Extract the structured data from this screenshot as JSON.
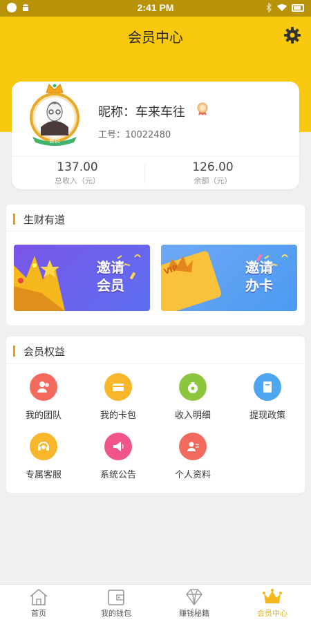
{
  "status_bar": {
    "time": "2:41 PM"
  },
  "header": {
    "title": "会员中心"
  },
  "profile": {
    "nickname": "昵称：车来车往",
    "employee_id": "工号：10022480",
    "avatar_badge": "会员",
    "stats": [
      {
        "value": "137.00",
        "label": "总收入（元）"
      },
      {
        "value": "126.00",
        "label": "余额（元）"
      }
    ]
  },
  "earn_section": {
    "title": "生财有道",
    "banners": [
      {
        "line1": "邀请",
        "line2": "会员"
      },
      {
        "line1": "邀请",
        "line2": "办卡",
        "tag": "VIP"
      }
    ]
  },
  "benefits_section": {
    "title": "会员权益",
    "items": [
      {
        "label": "我的团队",
        "icon": "team-icon",
        "color": "#f26a5e"
      },
      {
        "label": "我的卡包",
        "icon": "card-wallet-icon",
        "color": "#f8b62a"
      },
      {
        "label": "收入明细",
        "icon": "money-bag-icon",
        "color": "#8cc63f"
      },
      {
        "label": "提现政策",
        "icon": "book-icon",
        "color": "#4fa6f0"
      },
      {
        "label": "专属客服",
        "icon": "headset-icon",
        "color": "#f8b62a"
      },
      {
        "label": "系统公告",
        "icon": "megaphone-icon",
        "color": "#f0548a"
      },
      {
        "label": "个人资料",
        "icon": "profile-card-icon",
        "color": "#f26a5e"
      }
    ]
  },
  "tabbar": {
    "tabs": [
      {
        "label": "首页",
        "icon": "home-icon",
        "active": false
      },
      {
        "label": "我的钱包",
        "icon": "wallet-icon",
        "active": false
      },
      {
        "label": "赚钱秘籍",
        "icon": "diamond-icon",
        "active": false
      },
      {
        "label": "会员中心",
        "icon": "crown-icon",
        "active": true
      }
    ],
    "active_color": "#e8b10c"
  },
  "colors": {
    "header": "#f9c910",
    "accent": "#f39a10"
  }
}
